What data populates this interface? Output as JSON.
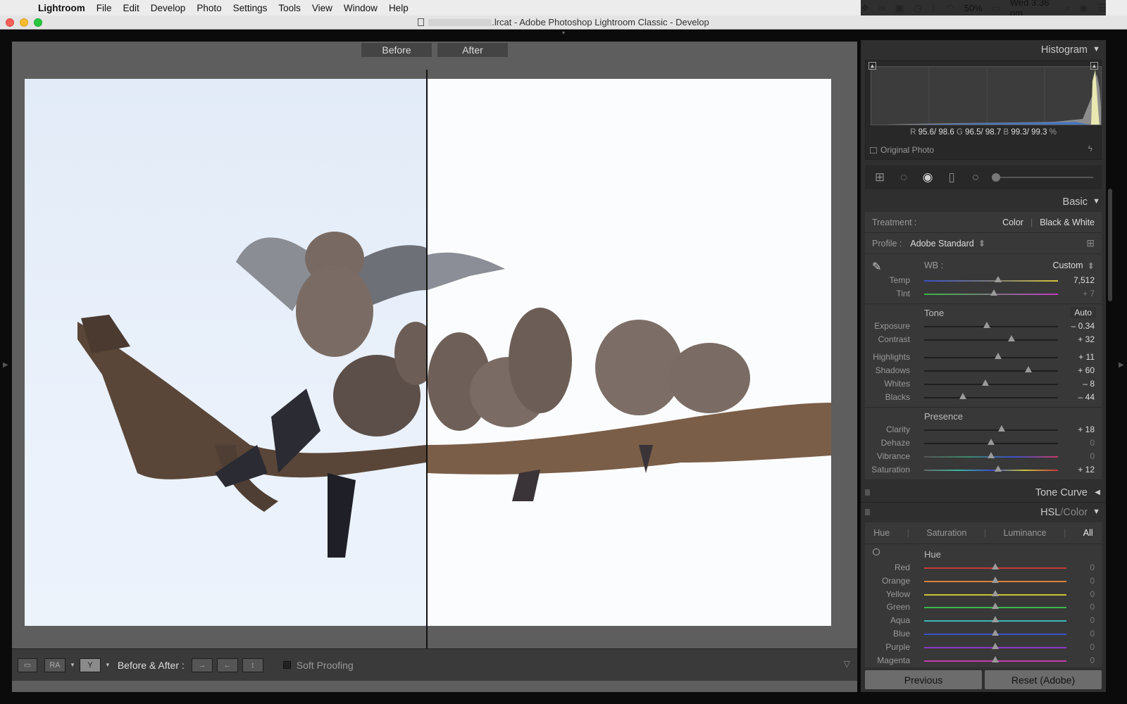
{
  "menubar": {
    "app": "Lightroom",
    "items": [
      "File",
      "Edit",
      "Develop",
      "Photo",
      "Settings",
      "Tools",
      "View",
      "Window",
      "Help"
    ],
    "battery": "50%",
    "clock": "Wed 3:36 pm"
  },
  "window": {
    "title": ".lrcat - Adobe Photoshop Lightroom Classic - Develop"
  },
  "view": {
    "before_label": "Before",
    "after_label": "After"
  },
  "toolbar": {
    "ry_label": "RA",
    "before_after_label": "Before & After :",
    "soft_proofing": "Soft Proofing",
    "soft_proofing_checked": false
  },
  "histogram": {
    "title": "Histogram",
    "r_label": "R",
    "r": "95.6/ 98.6",
    "g_label": "G",
    "g": "96.5/ 98.7",
    "b_label": "B",
    "b": "99.3/ 99.3",
    "unit": "%",
    "original_photo": "Original Photo"
  },
  "basic": {
    "title": "Basic",
    "treatment_label": "Treatment :",
    "treatment_color": "Color",
    "treatment_bw": "Black & White",
    "profile_label": "Profile :",
    "profile_value": "Adobe Standard",
    "wb_label": "WB :",
    "wb_value": "Custom",
    "tone_label": "Tone",
    "auto_label": "Auto",
    "presence_label": "Presence",
    "wb_sliders": [
      {
        "label": "Temp",
        "value": "7,512",
        "pos": 0.55,
        "gradient": "linear-gradient(90deg,#3a50c8,#7a7a7a,#d8c43a)"
      },
      {
        "label": "Tint",
        "value": "+ 7",
        "pos": 0.52,
        "gradient": "linear-gradient(90deg,#3ab84a,#7a7a7a,#c43ac8)",
        "dim": true
      }
    ],
    "tone_sliders": [
      {
        "label": "Exposure",
        "value": "– 0.34",
        "pos": 0.47
      },
      {
        "label": "Contrast",
        "value": "+ 32",
        "pos": 0.65
      }
    ],
    "tone2_sliders": [
      {
        "label": "Highlights",
        "value": "+ 11",
        "pos": 0.55
      },
      {
        "label": "Shadows",
        "value": "+ 60",
        "pos": 0.78
      },
      {
        "label": "Whites",
        "value": "– 8",
        "pos": 0.46
      },
      {
        "label": "Blacks",
        "value": "– 44",
        "pos": 0.29
      }
    ],
    "presence_sliders": [
      {
        "label": "Clarity",
        "value": "+ 18",
        "pos": 0.58,
        "gradient": ""
      },
      {
        "label": "Dehaze",
        "value": "0",
        "pos": 0.5,
        "gradient": "",
        "dim": true
      },
      {
        "label": "Vibrance",
        "value": "0",
        "pos": 0.5,
        "gradient": "linear-gradient(90deg,#555,#3a8a6a,#3a50c8,#c83a6a)",
        "dim": true
      },
      {
        "label": "Saturation",
        "value": "+ 12",
        "pos": 0.55,
        "gradient": "linear-gradient(90deg,#666,#3ab8a0,#3a50c8,#c8c43a,#c83a3a)"
      }
    ]
  },
  "tone_curve": {
    "title": "Tone Curve"
  },
  "hsl": {
    "title_hsl": "HSL",
    "title_sep": "/",
    "title_color": "Color",
    "tabs": [
      "Hue",
      "Saturation",
      "Luminance",
      "All"
    ],
    "section": "Hue",
    "rows": [
      {
        "label": "Red",
        "value": "0",
        "color": "#c83a3a"
      },
      {
        "label": "Orange",
        "value": "0",
        "color": "#d8803a"
      },
      {
        "label": "Yellow",
        "value": "0",
        "color": "#c8c43a"
      },
      {
        "label": "Green",
        "value": "0",
        "color": "#3ab84a"
      },
      {
        "label": "Aqua",
        "value": "0",
        "color": "#3ab8b8"
      },
      {
        "label": "Blue",
        "value": "0",
        "color": "#3a50c8"
      },
      {
        "label": "Purple",
        "value": "0",
        "color": "#8a3ac8"
      },
      {
        "label": "Magenta",
        "value": "0",
        "color": "#c83ab0"
      }
    ]
  },
  "buttons": {
    "previous": "Previous",
    "reset": "Reset (Adobe)"
  }
}
